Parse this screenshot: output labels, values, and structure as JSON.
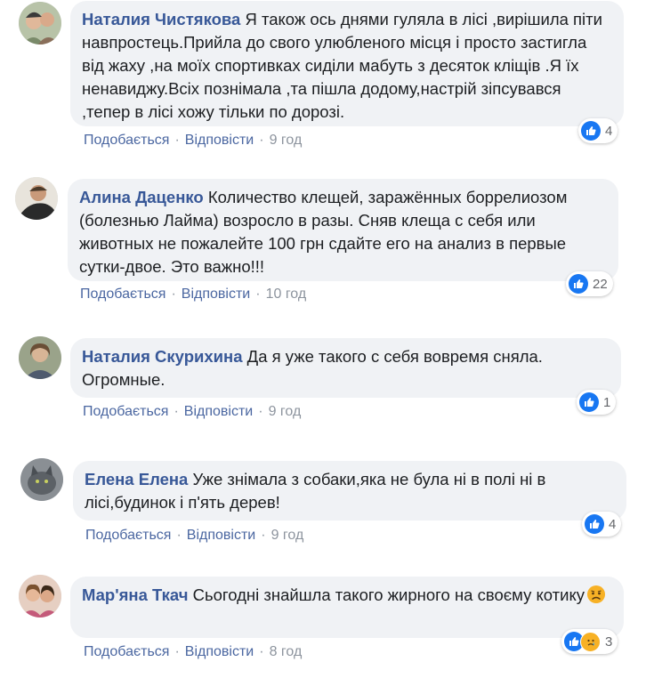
{
  "comments": [
    {
      "author": "Наталия Чистякова",
      "text": "Я також ось днями гуляла в лісі ,вирішила піти навпростець.Прийла до свого улюбленого місця і просто застигла від жаху ,на моїх спортивках сиділи мабуть з десяток кліщів .Я їх ненавиджу.Всіх познімала ,та пішла додому,настрій зіпсувався ,тепер в лісі хожу тільки по дорозі.",
      "like_label": "Подобається",
      "reply_label": "Відповісти",
      "time": "9 год",
      "reaction_count": "4"
    },
    {
      "author": "Алина Даценко",
      "text": "Количество клещей, заражённых боррелиозом (болезнью Лайма) возросло в разы. Сняв клеща с себя или животных не пожалейте 100 грн сдайте его на анализ в первые сутки-двое. Это важно!!!",
      "like_label": "Подобається",
      "reply_label": "Відповісти",
      "time": "10 год",
      "reaction_count": "22"
    },
    {
      "author": "Наталия Скурихина",
      "text": "Да я уже такого с себя вовремя сняла. Огромные.",
      "like_label": "Подобається",
      "reply_label": "Відповісти",
      "time": "9 год",
      "reaction_count": "1"
    },
    {
      "author": "Елена Елена",
      "text": "Уже знімала з собаки,яка не була ні в полі ні в лісі,будинок і п'ять дерев!",
      "like_label": "Подобається",
      "reply_label": "Відповісти",
      "time": "9 год",
      "reaction_count": "4"
    },
    {
      "author": "Мар'яна Ткач",
      "text": "Сьогодні знайшла такого жирного на своєму котику",
      "like_label": "Подобається",
      "reply_label": "Відповісти",
      "time": "8 год",
      "reaction_count": "3"
    }
  ],
  "colors": {
    "author": "#385898",
    "link": "#4b67a1",
    "bubble": "#f0f2f5",
    "like_blue": "#1877f2",
    "sad_yellow": "#f7b125"
  },
  "icons": [
    "like-reaction-icon",
    "sad-reaction-icon",
    "sad-emoji-icon"
  ]
}
